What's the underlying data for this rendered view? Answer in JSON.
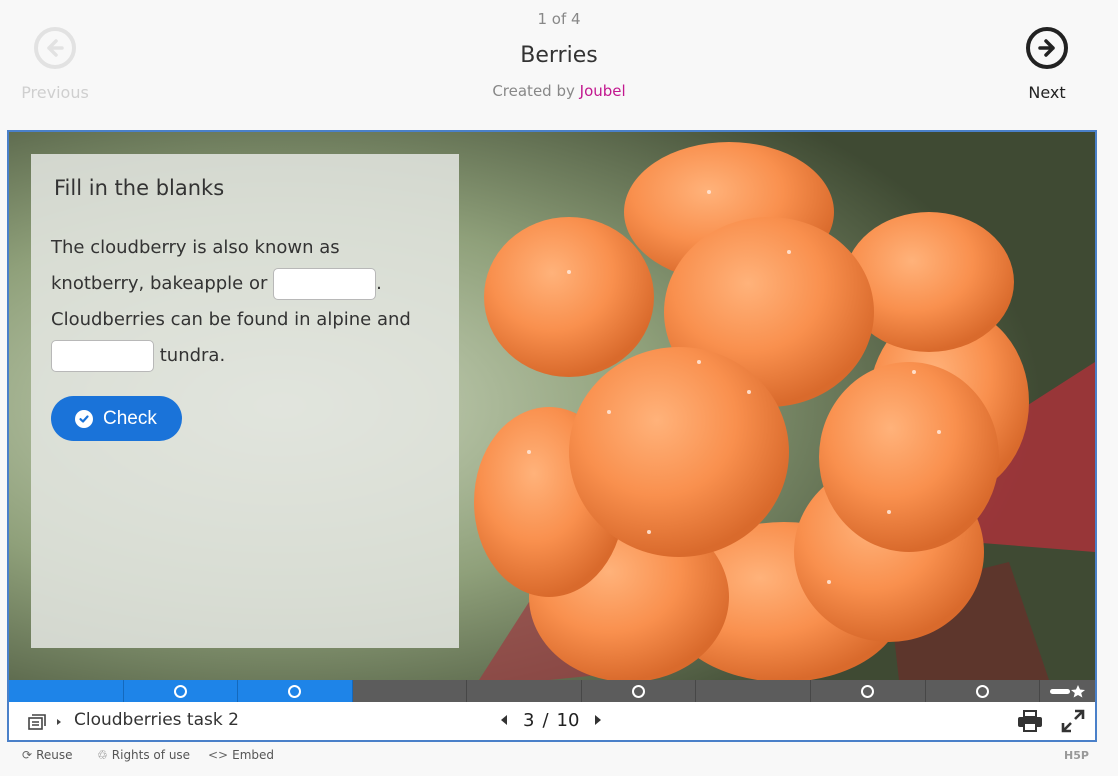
{
  "header": {
    "counter": "1 of 4",
    "title": "Berries",
    "created_by": "Created by",
    "author": "Joubel",
    "prev_label": "Previous",
    "next_label": "Next"
  },
  "panel": {
    "title": "Fill in the blanks",
    "text1": "The cloudberry is also known as knotberry, bakeapple or ",
    "text2": ". Cloudberries can be found in alpine and ",
    "text3": " tundra.",
    "check_label": "Check"
  },
  "progress": {
    "completed_segments": 3,
    "segments_with_dots": [
      1,
      2,
      5,
      7,
      8
    ]
  },
  "footer": {
    "slide_name": "Cloudberries task 2",
    "current": "3",
    "separator": "/",
    "total": "10"
  },
  "bottom": {
    "reuse": "Reuse",
    "rights": "Rights of use",
    "embed": "Embed",
    "brand": "H5P"
  },
  "colors": {
    "accent": "#1a73d9",
    "progress_done": "#1e84e8",
    "frame_border": "#4a80c9",
    "author_link": "#c2188f"
  }
}
